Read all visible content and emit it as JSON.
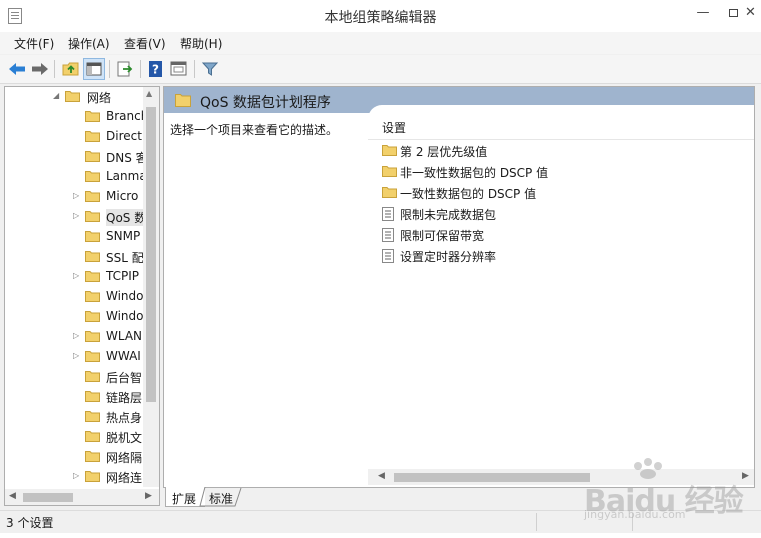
{
  "window": {
    "title": "本地组策略编辑器"
  },
  "menu": [
    "文件(F)",
    "操作(A)",
    "查看(V)",
    "帮助(H)"
  ],
  "toolbar": {
    "icons": [
      "back-arrow-icon",
      "forward-arrow-icon",
      "up-folder-icon",
      "show-hide-tree-icon",
      "export-list-icon",
      "help-icon",
      "properties-icon",
      "filter-icon"
    ]
  },
  "tree": {
    "items": [
      {
        "label": "网络",
        "expanded": true
      },
      {
        "label": "Branch",
        "expander": false
      },
      {
        "label": "Direct",
        "expander": false
      },
      {
        "label": "DNS 客",
        "expander": false
      },
      {
        "label": "Lanma",
        "expander": false
      },
      {
        "label": "Micro",
        "expander": true
      },
      {
        "label": "QoS 数",
        "expander": true,
        "selected": true
      },
      {
        "label": "SNMP",
        "expander": false
      },
      {
        "label": "SSL 配",
        "expander": false
      },
      {
        "label": "TCPIP",
        "expander": true
      },
      {
        "label": "Windo",
        "expander": false
      },
      {
        "label": "Windo",
        "expander": false
      },
      {
        "label": "WLAN",
        "expander": true
      },
      {
        "label": "WWAI",
        "expander": true
      },
      {
        "label": "后台智",
        "expander": false
      },
      {
        "label": "链路层",
        "expander": false
      },
      {
        "label": "热点身",
        "expander": false
      },
      {
        "label": "脱机文",
        "expander": false
      },
      {
        "label": "网络隔",
        "expander": false
      },
      {
        "label": "网络连",
        "expander": true
      }
    ]
  },
  "right": {
    "header": "QoS 数据包计划程序",
    "description": "选择一个项目来查看它的描述。",
    "column_header": "设置",
    "items": [
      {
        "label": "第 2 层优先级值",
        "kind": "folder"
      },
      {
        "label": "非一致性数据包的 DSCP 值",
        "kind": "folder"
      },
      {
        "label": "一致性数据包的 DSCP 值",
        "kind": "folder"
      },
      {
        "label": "限制未完成数据包",
        "kind": "setting"
      },
      {
        "label": "限制可保留带宽",
        "kind": "setting"
      },
      {
        "label": "设置定时器分辨率",
        "kind": "setting"
      }
    ]
  },
  "tabs": [
    "扩展",
    "标准"
  ],
  "status": {
    "text": "3 个设置"
  },
  "watermark": {
    "text": "Baidu 经验",
    "sub": "jingyan.baidu.com"
  },
  "colors": {
    "header_band": "#9fb4ce",
    "folder_yellow": "#f2d06b",
    "selection": "#e5e5e5"
  }
}
